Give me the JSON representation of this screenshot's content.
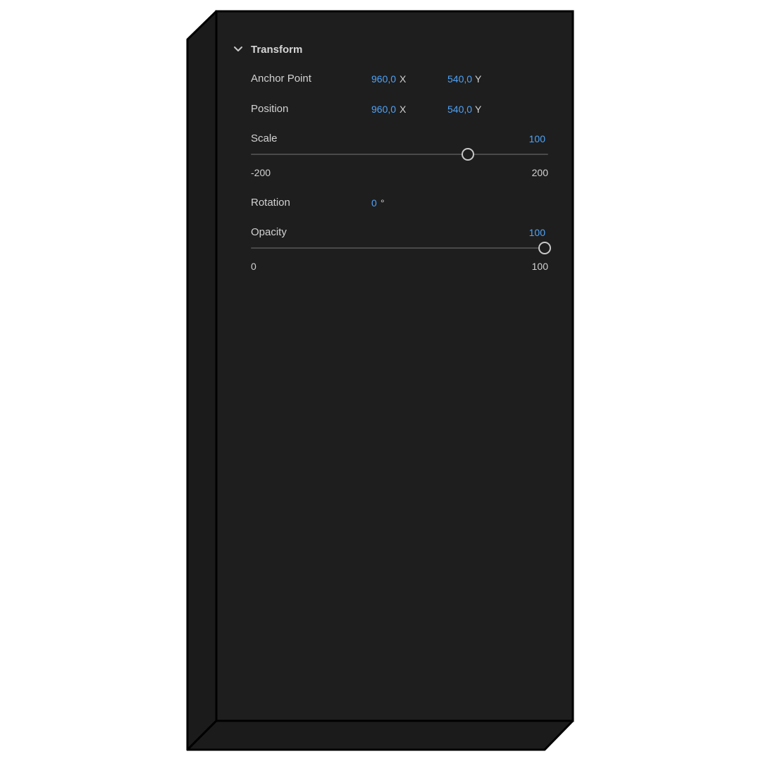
{
  "transform": {
    "title": "Transform",
    "expand_icon": "chevron-down-icon",
    "anchor_point": {
      "label": "Anchor Point",
      "x_value": "960,0",
      "x_unit": "X",
      "y_value": "540,0",
      "y_unit": "Y"
    },
    "position": {
      "label": "Position",
      "x_value": "960,0",
      "x_unit": "X",
      "y_value": "540,0",
      "y_unit": "Y"
    },
    "scale": {
      "label": "Scale",
      "value": "100",
      "min": "-200",
      "max": "200",
      "slider_fraction": 0.73
    },
    "rotation": {
      "label": "Rotation",
      "value": "0",
      "unit": "°"
    },
    "opacity": {
      "label": "Opacity",
      "value": "100",
      "min": "0",
      "max": "100",
      "slider_fraction": 1.0
    }
  },
  "colors": {
    "panel_background": "#1e1e1e",
    "value_blue": "#4fa3f7",
    "text": "#d2d2d2"
  }
}
